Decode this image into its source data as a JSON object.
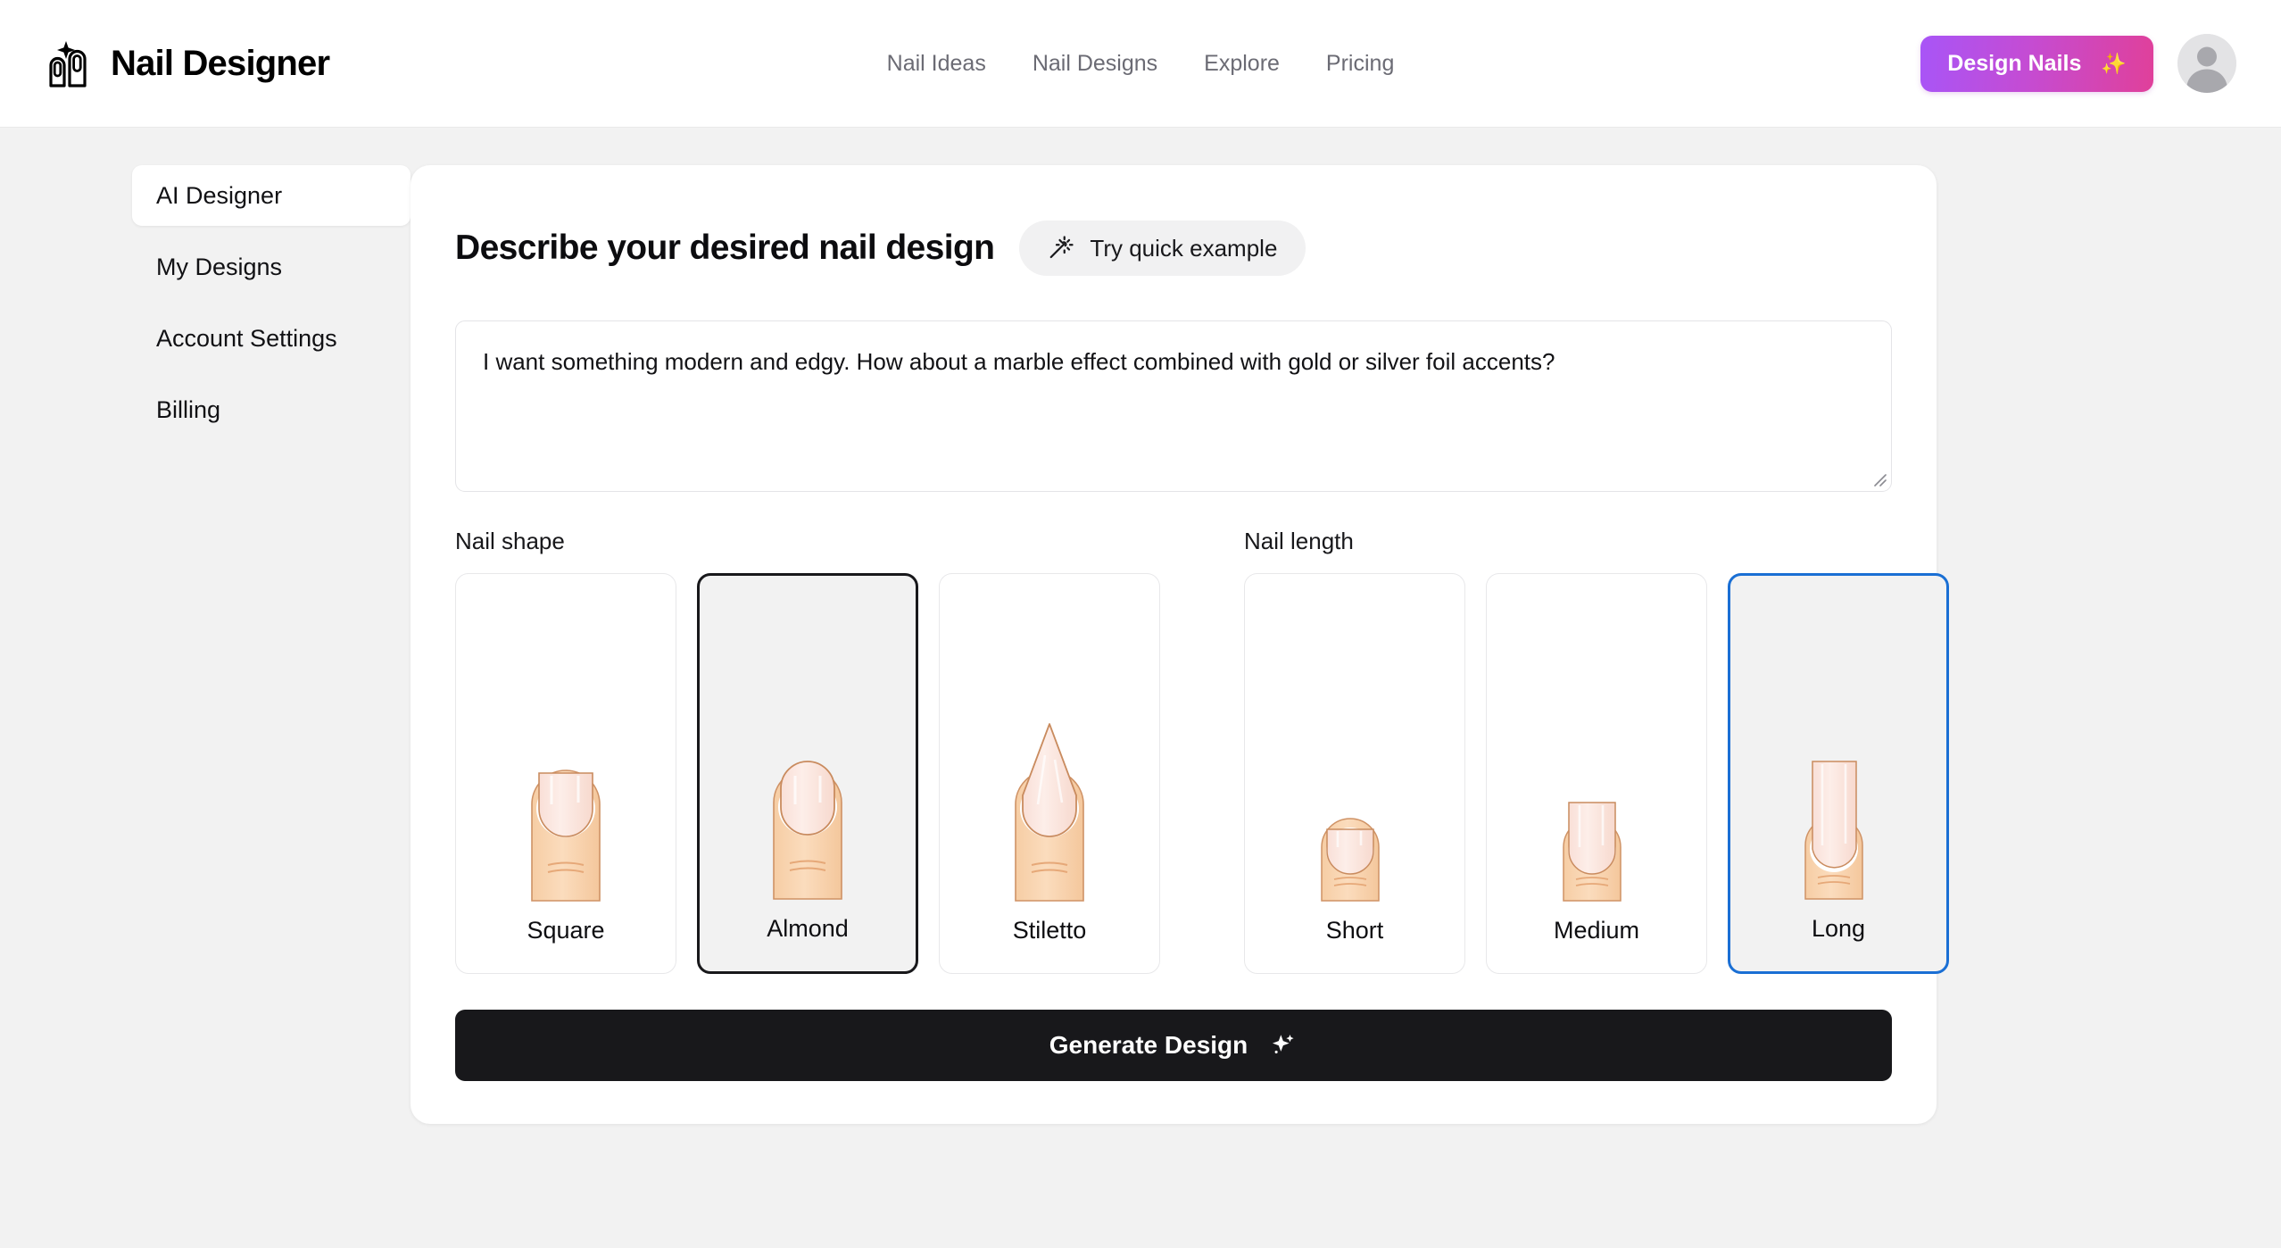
{
  "header": {
    "brand": "Nail Designer",
    "logo_icon": "nail-sparkle-logo-icon",
    "nav": [
      {
        "label": "Nail Ideas"
      },
      {
        "label": "Nail Designs"
      },
      {
        "label": "Explore"
      },
      {
        "label": "Pricing"
      }
    ],
    "cta": {
      "label": "Design Nails",
      "sparkle": "✨",
      "gradient_from": "#a855f7",
      "gradient_to": "#e0409a"
    },
    "avatar_icon": "user-avatar-icon"
  },
  "sidebar": {
    "items": [
      {
        "label": "AI Designer",
        "active": true
      },
      {
        "label": "My Designs",
        "active": false
      },
      {
        "label": "Account Settings",
        "active": false
      },
      {
        "label": "Billing",
        "active": false
      }
    ]
  },
  "main": {
    "title": "Describe your desired nail design",
    "quick_example": {
      "label": "Try quick example",
      "icon": "magic-wand-icon"
    },
    "prompt": {
      "value": "I want something modern and edgy. How about a marble effect combined with gold or silver foil accents?",
      "placeholder": "Describe your desired nail design..."
    },
    "shape": {
      "label": "Nail shape",
      "selected": "Almond",
      "options": [
        {
          "label": "Square",
          "icon": "nail-square-icon",
          "selected": false
        },
        {
          "label": "Almond",
          "icon": "nail-almond-icon",
          "selected": true
        },
        {
          "label": "Stiletto",
          "icon": "nail-stiletto-icon",
          "selected": false
        }
      ]
    },
    "length": {
      "label": "Nail length",
      "selected": "Long",
      "options": [
        {
          "label": "Short",
          "icon": "nail-short-icon",
          "selected": false
        },
        {
          "label": "Medium",
          "icon": "nail-medium-icon",
          "selected": false
        },
        {
          "label": "Long",
          "icon": "nail-long-icon",
          "selected": true
        }
      ]
    },
    "generate": {
      "label": "Generate Design",
      "icon": "sparkles-icon"
    }
  },
  "colors": {
    "page_bg": "#f2f2f2",
    "card_bg": "#ffffff",
    "accent_dark": "#18181b",
    "selected_blue": "#1a6fd4",
    "skin": "#f8d3ac",
    "nail": "#fbe0d8"
  }
}
